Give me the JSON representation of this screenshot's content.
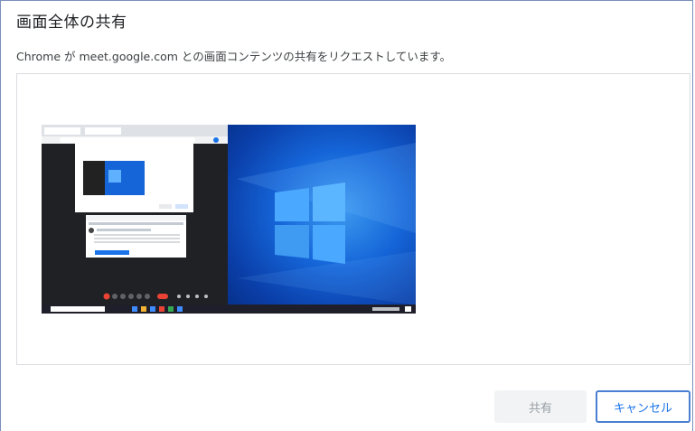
{
  "dialog": {
    "title": "画面全体の共有",
    "subtitle": "Chrome が meet.google.com との画面コンテンツの共有をリクエストしています。"
  },
  "buttons": {
    "share_label": "共有",
    "cancel_label": "キャンセル"
  },
  "thumbnail": {
    "left_window": {
      "theme": "dark",
      "meet_controls_color": "#ea4335"
    },
    "desktop_colors": {
      "primary": "#1565d8",
      "highlight": "#3d9bf0",
      "dark": "#062f86"
    }
  }
}
